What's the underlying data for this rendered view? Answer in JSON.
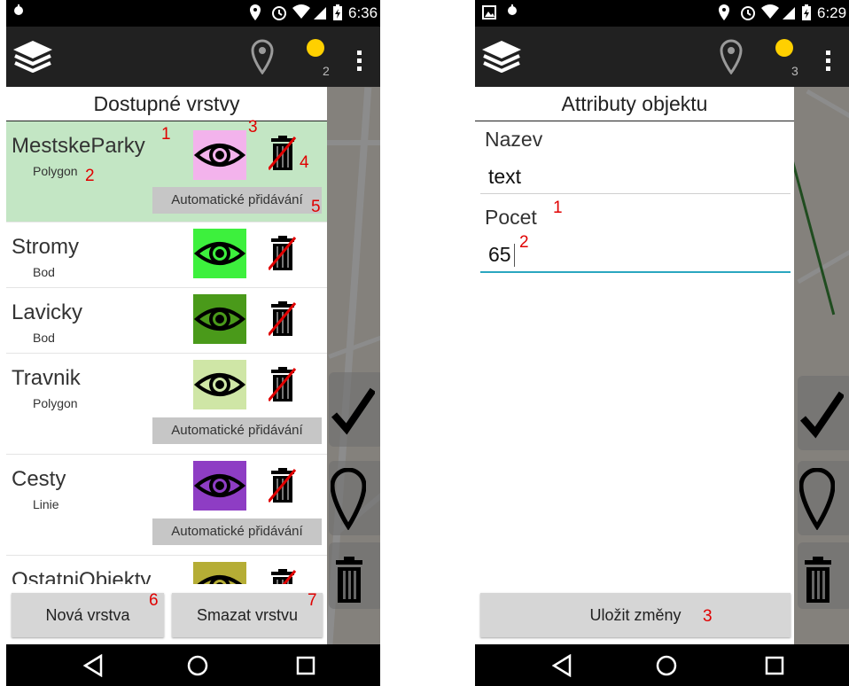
{
  "colors": {
    "selected_row": "#c3e6c4",
    "annotation": "#e00000",
    "location_dot": "#ffd000",
    "focus_line": "#2aa6c0"
  },
  "left": {
    "status": {
      "time": "6:36"
    },
    "appbar": {
      "count": "2"
    },
    "panel_title": "Dostupné vrstvy",
    "layers": [
      {
        "name": "MestskeParky",
        "type": "Polygon",
        "color": "#f3b3ec",
        "auto": "Automatické přidávání"
      },
      {
        "name": "Stromy",
        "type": "Bod",
        "color": "#3df03d"
      },
      {
        "name": "Lavicky",
        "type": "Bod",
        "color": "#4a9a1a"
      },
      {
        "name": "Travnik",
        "type": "Polygon",
        "color": "#cfe6a6",
        "auto": "Automatické přidávání"
      },
      {
        "name": "Cesty",
        "type": "Linie",
        "color": "#8e3dc4",
        "auto": "Automatické přidávání"
      },
      {
        "name": "OstatniObjekty",
        "color": "#b5ad35"
      }
    ],
    "buttons": {
      "new_layer": "Nová vrstva",
      "delete_layer": "Smazat vrstvu"
    },
    "annotations": [
      "1",
      "2",
      "3",
      "4",
      "5",
      "6",
      "7"
    ]
  },
  "right": {
    "status": {
      "time": "6:29"
    },
    "appbar": {
      "count": "3"
    },
    "panel_title": "Attributy objektu",
    "fields": [
      {
        "label": "Nazev",
        "value": "text"
      },
      {
        "label": "Pocet",
        "value": "65"
      }
    ],
    "save": "Uložit změny",
    "annotations": [
      "1",
      "2",
      "3"
    ]
  }
}
